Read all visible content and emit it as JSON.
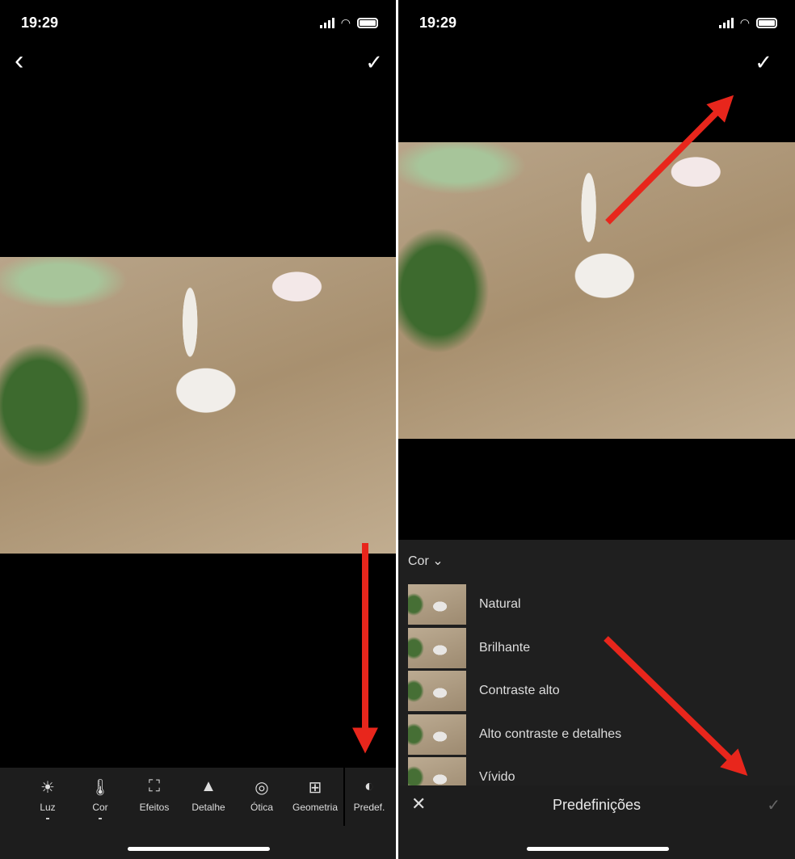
{
  "status": {
    "time": "19:29",
    "location_icon": "location-arrow-icon",
    "signal_icon": "signal-icon",
    "wifi_icon": "wifi-icon",
    "battery_icon": "battery-icon"
  },
  "left": {
    "back_icon": "chevron-left-icon",
    "back": "‹",
    "confirm": "✓",
    "tools": [
      {
        "label": "Luz",
        "icon": "sun-icon",
        "glyph": "☀",
        "dot": true
      },
      {
        "label": "Cor",
        "icon": "thermometer-icon",
        "glyph": "🌡",
        "dot": true
      },
      {
        "label": "Efeitos",
        "icon": "vignette-icon",
        "glyph": "⛶",
        "dot": false
      },
      {
        "label": "Detalhe",
        "icon": "triangle-icon",
        "glyph": "▲",
        "dot": false
      },
      {
        "label": "Ótica",
        "icon": "lens-icon",
        "glyph": "◎",
        "dot": false
      },
      {
        "label": "Geometria",
        "icon": "geometry-icon",
        "glyph": "⊞",
        "dot": false
      },
      {
        "label": "Predef.",
        "icon": "presets-icon",
        "glyph": "◐",
        "dot": false
      }
    ]
  },
  "right": {
    "confirm": "✓",
    "category": "Cor",
    "presets": [
      "Natural",
      "Brilhante",
      "Contraste alto",
      "Alto contraste e detalhes",
      "Vívido"
    ],
    "title": "Predefinições",
    "close": "✕",
    "apply": "✓"
  },
  "colors": {
    "annotation_arrow": "#e8261c",
    "panel_bg": "#1f1f1f"
  }
}
